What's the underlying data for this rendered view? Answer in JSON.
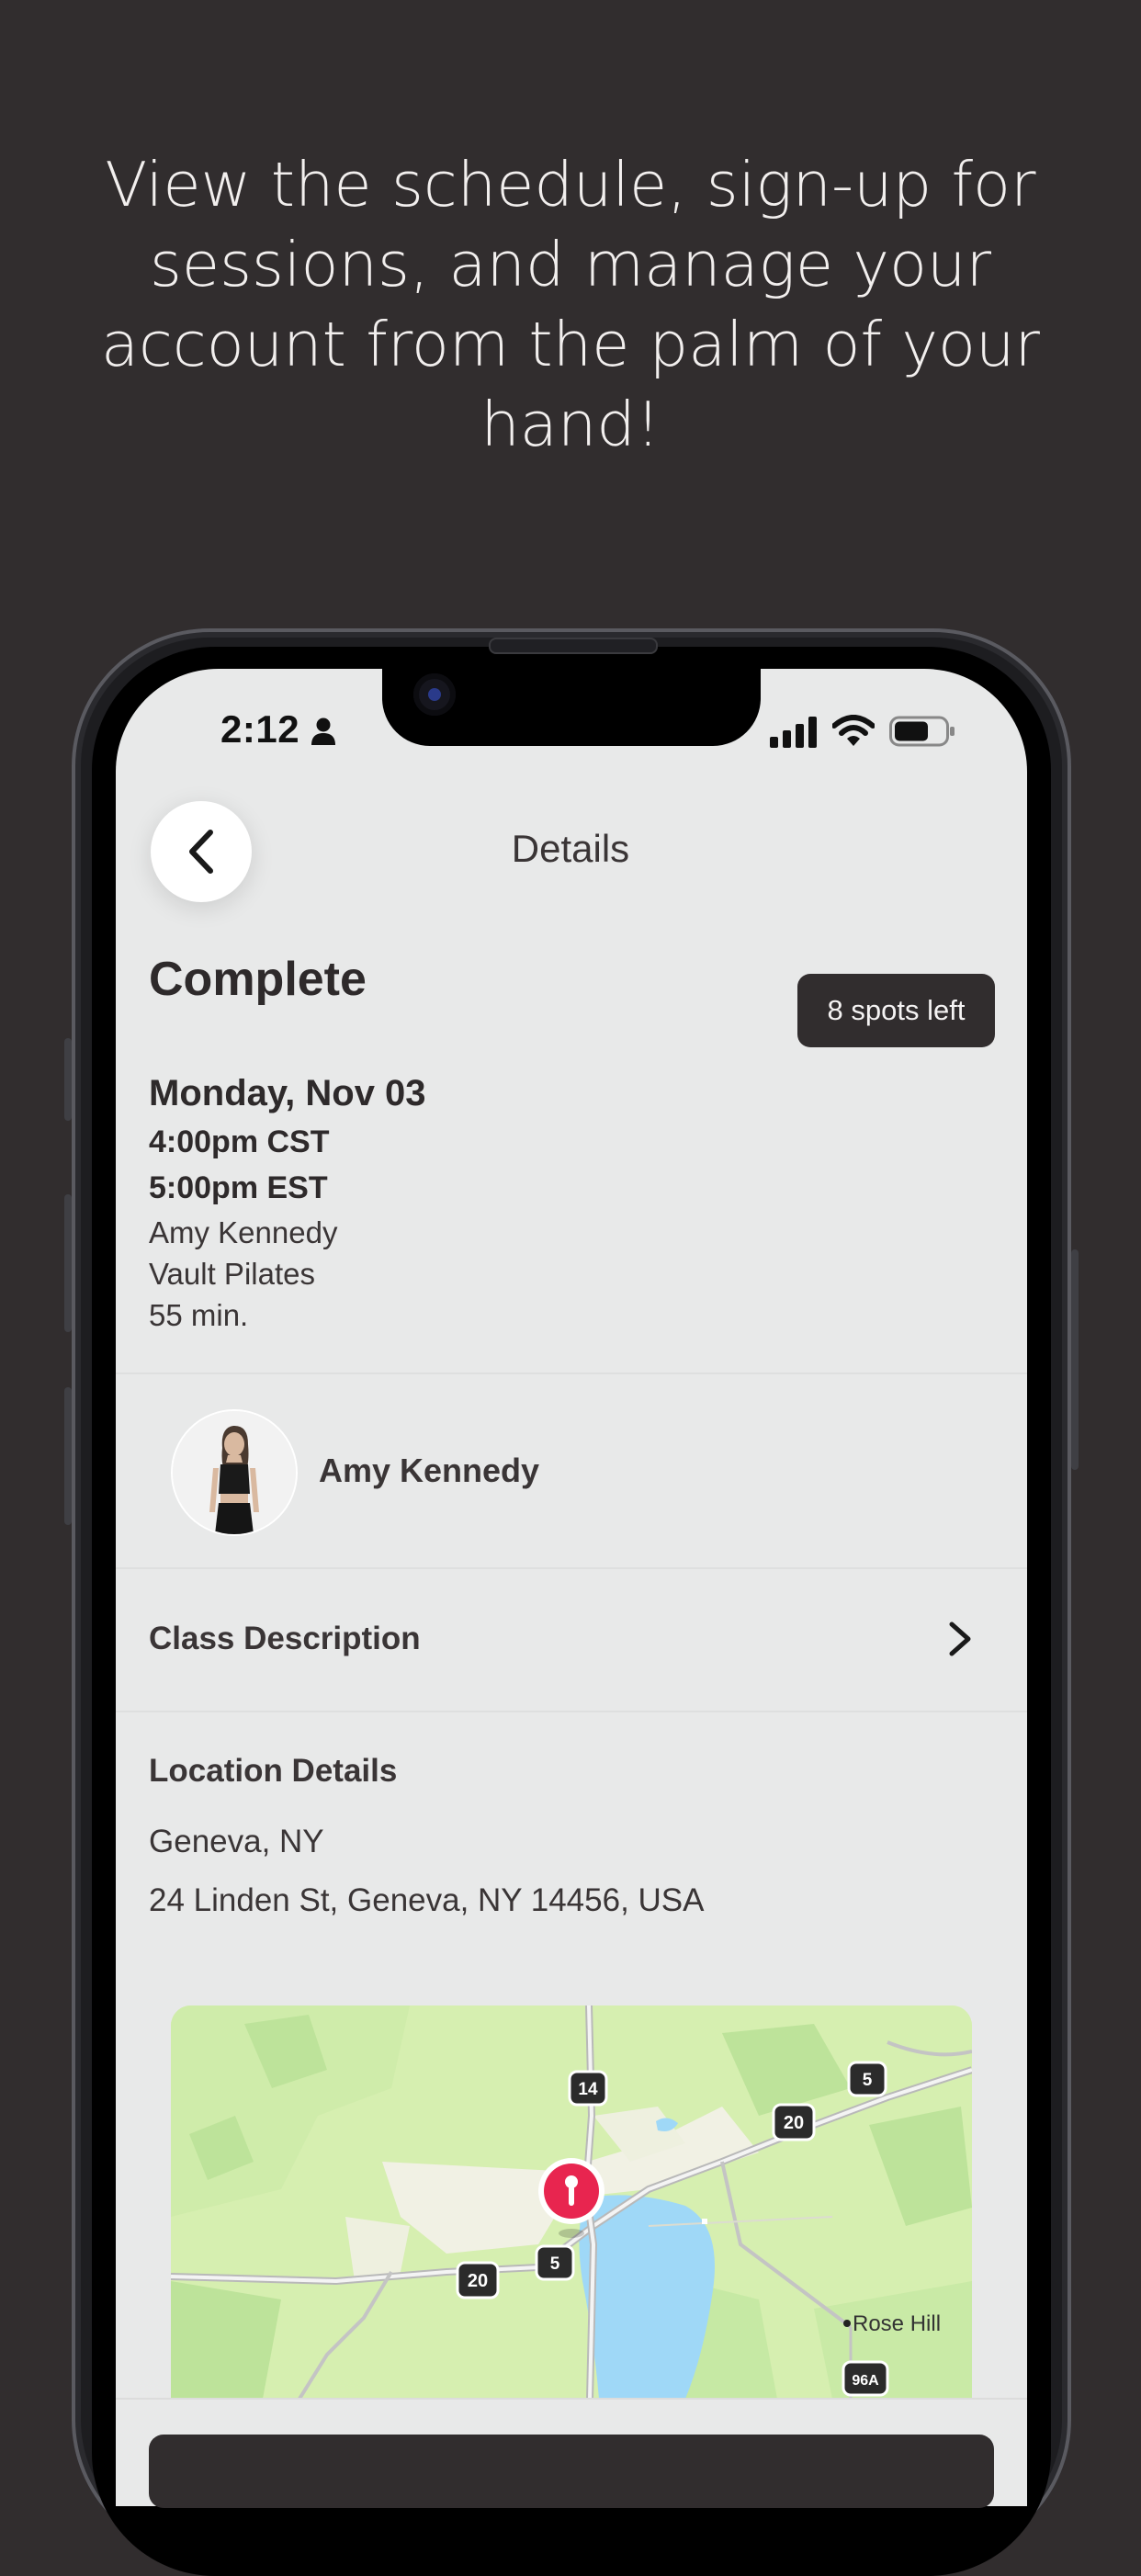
{
  "headline": "View the schedule, sign-up for sessions, and manage your account from the palm of your hand!",
  "status_bar": {
    "time": "2:12"
  },
  "nav": {
    "title": "Details"
  },
  "class": {
    "status": "Complete",
    "spots": "8 spots left",
    "date": "Monday, Nov 03",
    "time_cst": "4:00pm CST",
    "time_est": "5:00pm EST",
    "instructor": "Amy Kennedy",
    "studio": "Vault Pilates",
    "duration": "55 min."
  },
  "instructor_row": {
    "name": "Amy Kennedy"
  },
  "description_row": {
    "label": "Class Description"
  },
  "location": {
    "heading": "Location Details",
    "city": "Geneva, NY",
    "address": "24 Linden St, Geneva, NY 14456, USA"
  },
  "map": {
    "place_label": "Rose Hill",
    "shields": [
      "14",
      "5",
      "20",
      "20",
      "5",
      "96A"
    ]
  },
  "colors": {
    "background": "#312d2e",
    "screen": "#e8e9e9",
    "badge": "#312d2e",
    "pin": "#e8254f"
  }
}
